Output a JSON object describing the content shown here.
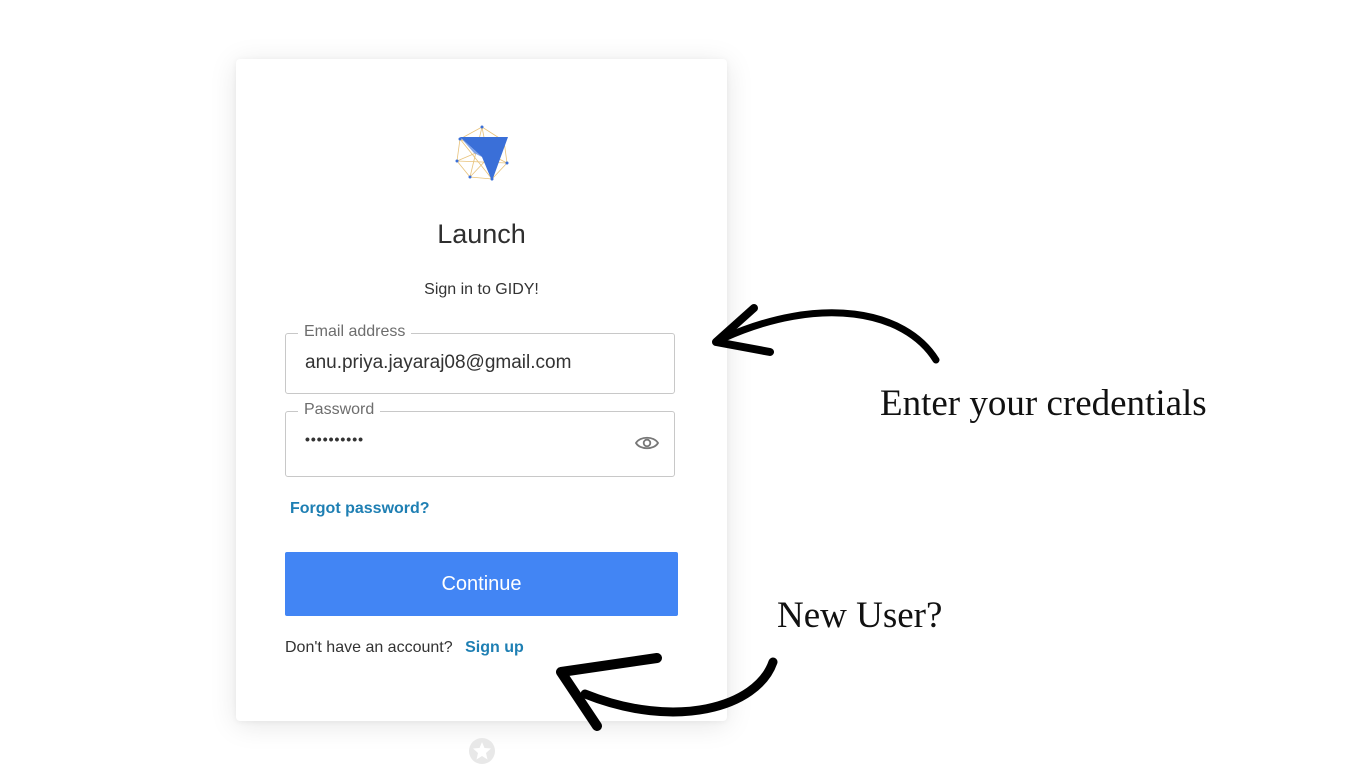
{
  "card": {
    "title": "Launch",
    "subtitle": "Sign in to GIDY!",
    "email": {
      "label": "Email address",
      "value": "anu.priya.jayaraj08@gmail.com"
    },
    "password": {
      "label": "Password",
      "value": "••••••••••"
    },
    "forgot_label": "Forgot password?",
    "continue_label": "Continue",
    "signup_prompt": "Don't have an account?",
    "signup_label": "Sign up"
  },
  "annotations": {
    "credentials_text": "Enter your credentials",
    "new_user_text": "New User?"
  },
  "colors": {
    "primary_button": "#4285f4",
    "link": "#1e7fb3",
    "logo_blue": "#3a6fd8",
    "logo_lines": "#e8c27a"
  },
  "icons": {
    "logo": "gidy-logo-icon",
    "password_toggle": "eye-icon",
    "badge": "star-badge-icon"
  }
}
